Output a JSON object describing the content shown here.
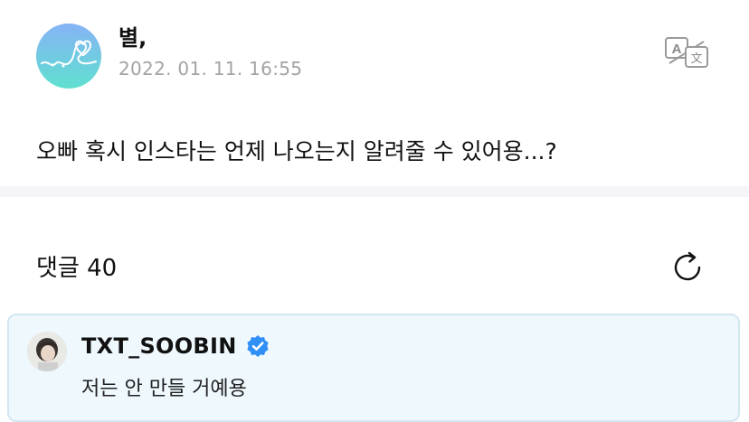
{
  "post": {
    "author": "별,",
    "date": "2022. 01. 11. 16:55",
    "body": "오빠 혹시 인스타는 언제 나오는지 알려줄 수 있어용...?"
  },
  "comments": {
    "header": "댓글 40",
    "items": [
      {
        "author": "TXT_SOOBIN",
        "verified": true,
        "text": "저는 안 만들 거예용"
      }
    ]
  },
  "icons": {
    "translate": "translate-icon",
    "refresh": "refresh-icon",
    "verified": "verified-badge-icon"
  },
  "colors": {
    "avatar_gradient_top": "#7fb6f5",
    "avatar_gradient_bottom": "#62dfd0",
    "verified_blue": "#2f8ff5",
    "comment_bg": "#eef8fd",
    "date_gray": "#a3a3a3"
  }
}
